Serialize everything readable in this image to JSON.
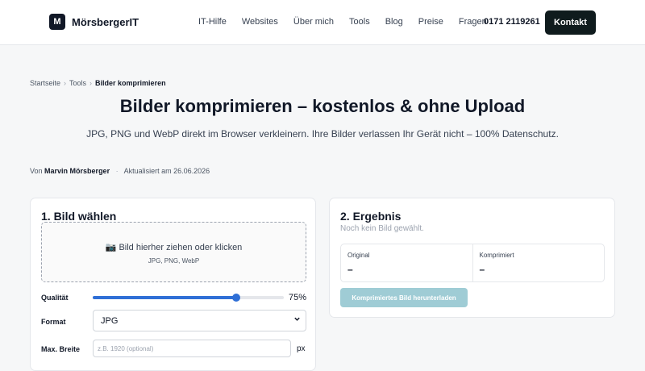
{
  "header": {
    "logo_mark": "M",
    "logo_text": "MörsbergerIT",
    "nav": [
      "IT-Hilfe",
      "Websites",
      "Über mich",
      "Tools",
      "Blog",
      "Preise",
      "Fragen"
    ],
    "phone": "0171 2119261",
    "contact_label": "Kontakt"
  },
  "breadcrumb": {
    "home": "Startseite",
    "section": "Tools",
    "current": "Bilder komprimieren",
    "separator": "›"
  },
  "title": "Bilder komprimieren – kostenlos & ohne Upload",
  "subtitle": "JPG, PNG und WebP direkt im Browser verkleinern. Ihre Bilder verlassen Ihr Gerät nicht – 100% Datenschutz.",
  "byline": {
    "prefix": "Von",
    "author": "Marvin Mörsberger",
    "separator": "·",
    "updated": "Aktualisiert am 26.06.2026"
  },
  "step1": {
    "title": "1. Bild wählen",
    "drop_main": "📷 Bild hierher ziehen oder klicken",
    "drop_sub": "JPG, PNG, WebP",
    "quality_label": "Qualität",
    "quality_value": 75,
    "quality_text": "75%",
    "format_label": "Format",
    "format_value": "JPG",
    "maxwidth_label": "Max. Breite",
    "maxwidth_placeholder": "z.B. 1920 (optional)",
    "maxwidth_unit": "px"
  },
  "step2": {
    "title": "2. Ergebnis",
    "hint": "Noch kein Bild gewählt.",
    "original_label": "Original",
    "original_value": "–",
    "compressed_label": "Komprimiert",
    "compressed_value": "–",
    "download_label": "Komprimiertes Bild herunterladen"
  },
  "colors": {
    "accent": "#2f6fd6",
    "button_dark": "#0f1b1d",
    "button_disabled": "#9fccd5"
  }
}
